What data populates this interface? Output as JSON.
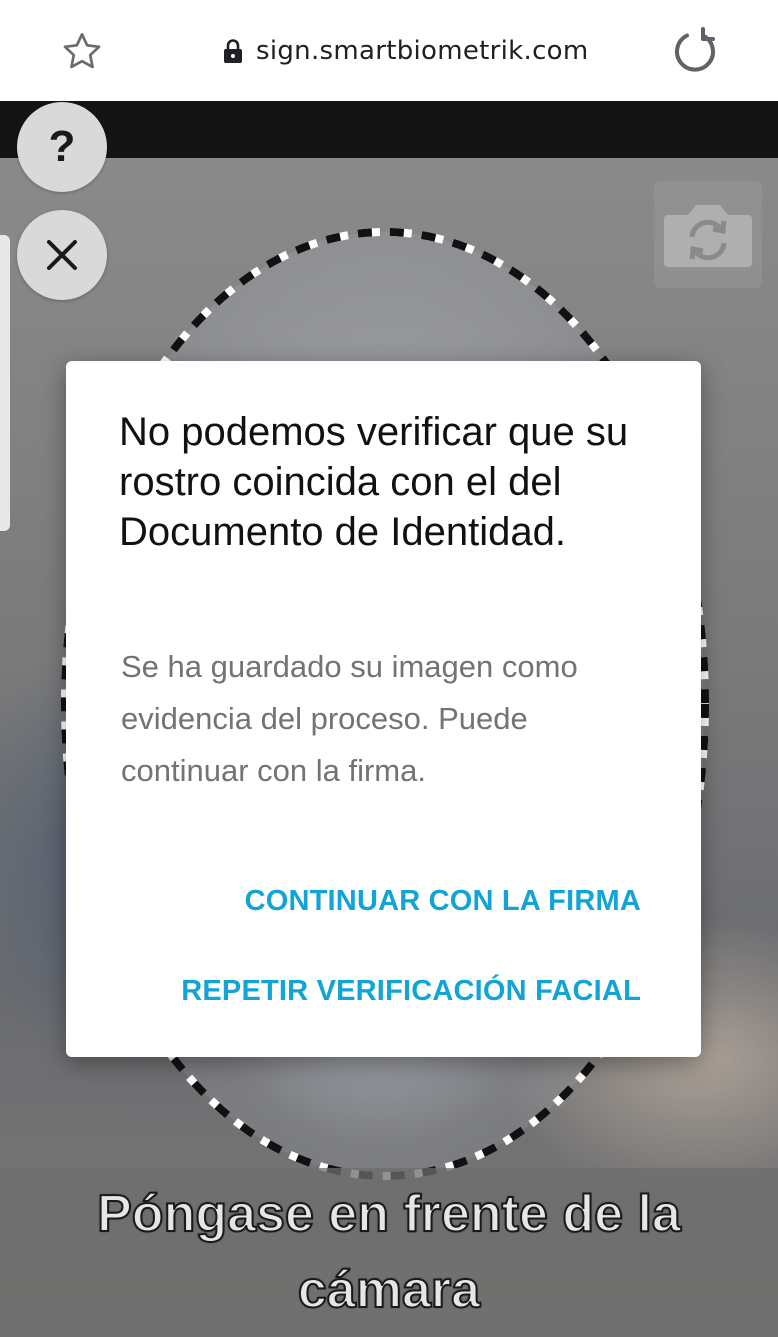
{
  "browser": {
    "url": "sign.smartbiometrik.com",
    "icons": [
      "star-icon",
      "lock-icon",
      "reload-icon"
    ]
  },
  "camera": {
    "help_label": "?",
    "icons": [
      "help-icon",
      "close-icon",
      "camera-switch-icon"
    ]
  },
  "dialog": {
    "title": "No podemos verificar que su rostro coincida con el del Documento de Identidad.",
    "message": "Se ha guardado su imagen como evidencia del proceso. Puede continuar con la firma.",
    "continue_label": "CONTINUAR CON LA FIRMA",
    "repeat_label": "REPETIR VERIFICACIÓN FACIAL"
  },
  "caption": {
    "text": "Póngase en frente de la cámara"
  },
  "colors": {
    "accent": "#12a4d6",
    "dialog_bg": "#ffffff",
    "title": "#111111",
    "message": "#737373"
  }
}
